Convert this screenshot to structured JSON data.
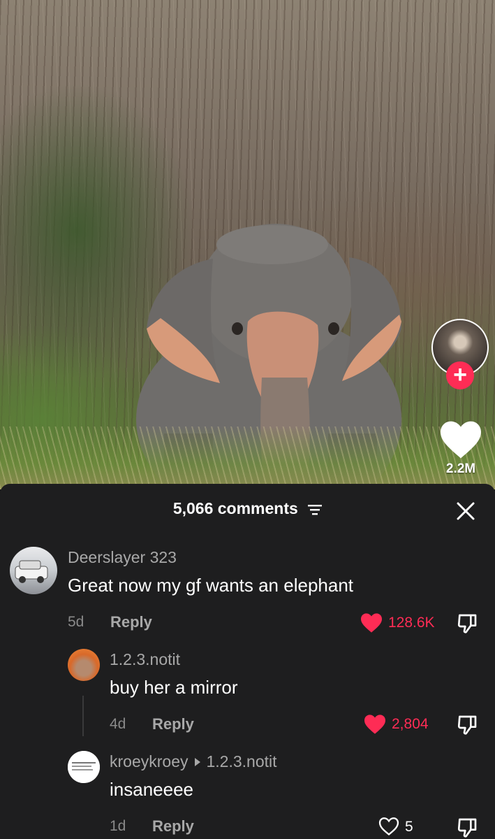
{
  "video": {
    "like_count": "2.2M"
  },
  "comments_sheet": {
    "title": "5,066 comments",
    "close_label": "×"
  },
  "comments": [
    {
      "username": "Deerslayer 323",
      "text": "Great now my gf wants an elephant",
      "time": "5d",
      "reply_label": "Reply",
      "likes": "128.6K",
      "liked": true
    },
    {
      "username": "1.2.3.notit",
      "text": "buy her a mirror",
      "time": "4d",
      "reply_label": "Reply",
      "likes": "2,804",
      "liked": true
    },
    {
      "username": "kroeykroey",
      "reply_to": "1.2.3.notit",
      "text": "insaneeee",
      "time": "1d",
      "reply_label": "Reply",
      "likes": "5",
      "liked": false
    }
  ],
  "colors": {
    "accent_red": "#fe2c55",
    "sheet_bg": "#1e1e1f",
    "muted_text": "#a8a8a8"
  },
  "icons": [
    "heart-icon",
    "dislike-icon",
    "filter-icon",
    "close-icon",
    "plus-icon"
  ]
}
